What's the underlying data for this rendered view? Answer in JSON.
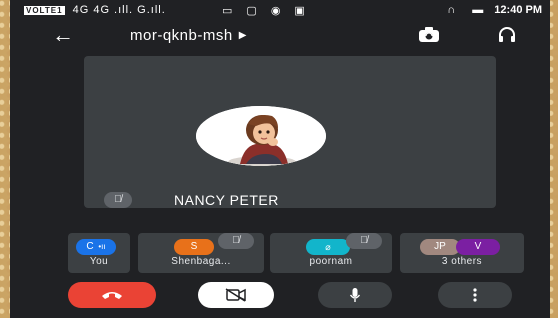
{
  "status_bar": {
    "volte": "VOLTE1",
    "network": "4G 4G .ıll. G.ıll.",
    "time": "12:40 PM"
  },
  "topbar": {
    "meeting_code": "mor-qknb-msh",
    "back_icon": "arrow-left-icon",
    "camera_switch_icon": "camera-switch-icon",
    "audio_icon": "headphones-icon"
  },
  "main_tile": {
    "participant_name": "NANCY PETER",
    "muted": true
  },
  "participants": [
    {
      "label": "You",
      "initial": "C",
      "color": "#1a73e8"
    },
    {
      "label": "Shenbaga...",
      "initial": "S",
      "color": "#e8711a",
      "muted": true
    },
    {
      "label": "poornam",
      "initial": "",
      "color": "#12b5cb",
      "muted": true
    },
    {
      "label": "3 others",
      "initials": [
        "JP",
        "V"
      ],
      "colors": [
        "#a1887f",
        "#7b1fa2"
      ]
    }
  ],
  "controls": {
    "end_call_color": "#ea4335",
    "buttons": [
      "end-call",
      "camera-off",
      "microphone",
      "more-options"
    ]
  }
}
